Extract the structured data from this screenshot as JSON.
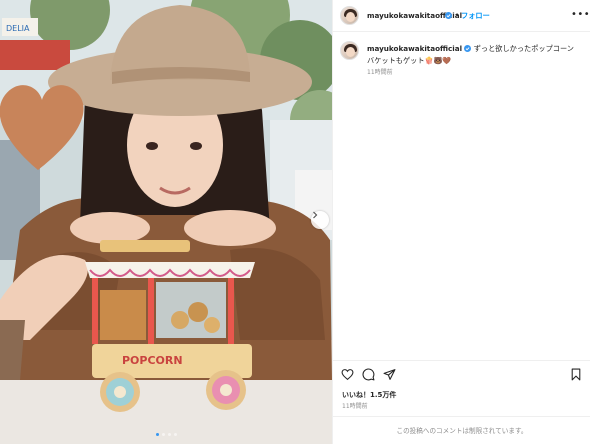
{
  "post": {
    "username": "mayukokawakitaofficial",
    "follow_label": "フォロー",
    "separator": "•",
    "more_label": "•••",
    "caption_text": "ずっと欲しかったポップコーンバケットもゲット🍿🐻🤎",
    "time_ago": "11時間前",
    "likes": "いいね！1.5万件",
    "post_time": "11時間前",
    "comments_restricted": "この投稿へのコメントは制限されています。"
  },
  "media": {
    "carousel_count": 4,
    "carousel_active": 1
  },
  "colors": {
    "link": "#0095f6",
    "verified": "#3897f0",
    "text": "#262626",
    "muted": "#8e8e8e"
  },
  "icons": [
    "verified-badge-icon",
    "heart-icon",
    "comment-icon",
    "share-icon",
    "bookmark-icon",
    "next-arrow-icon"
  ]
}
